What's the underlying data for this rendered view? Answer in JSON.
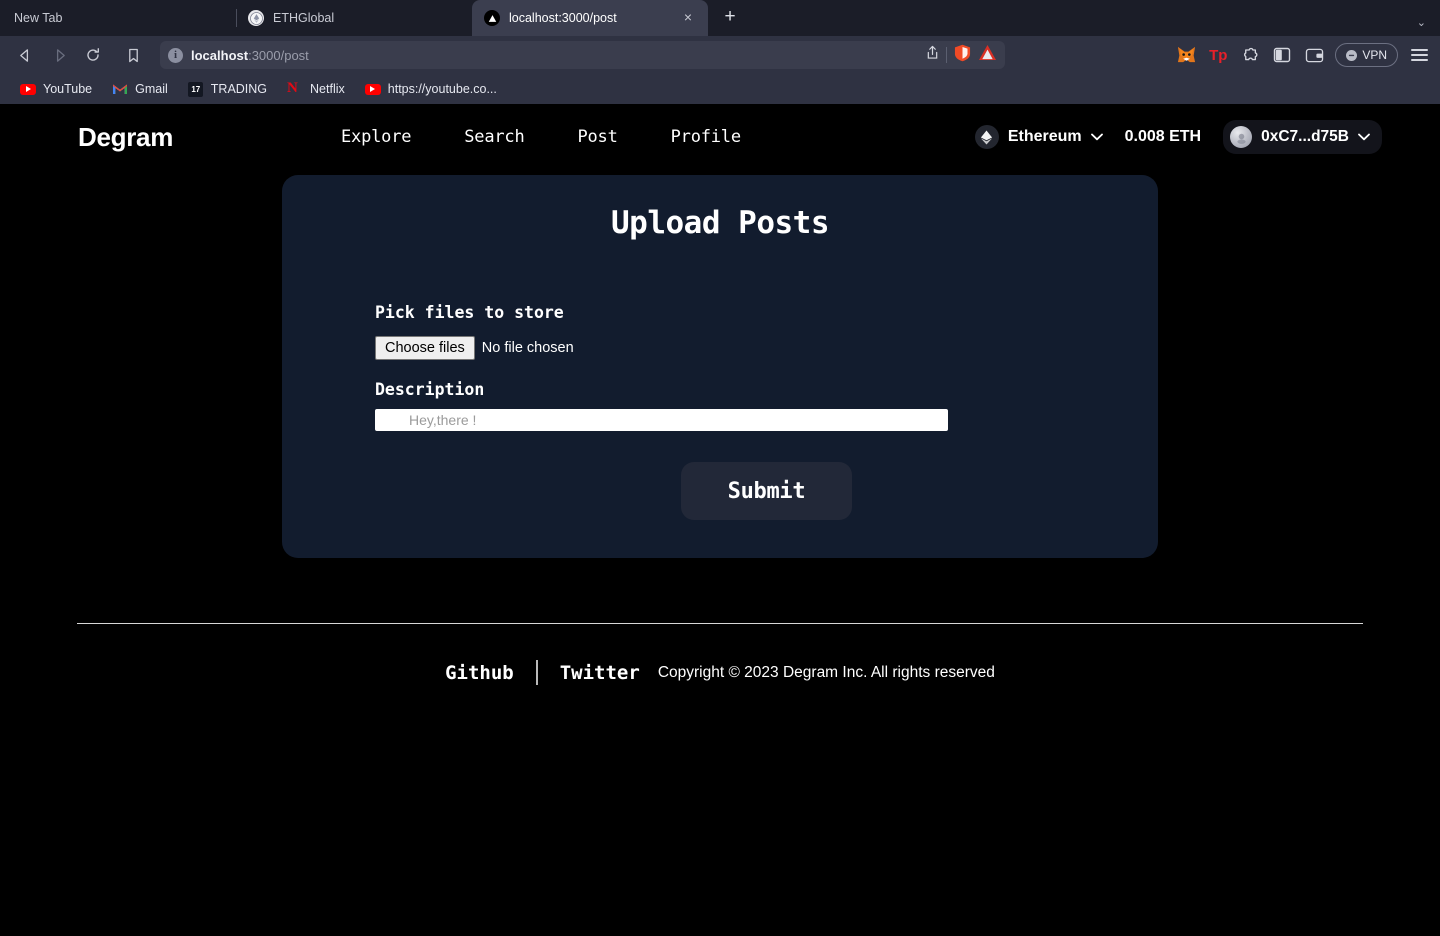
{
  "browser": {
    "tabs": [
      {
        "title": "New Tab",
        "favicon": "none",
        "active": false
      },
      {
        "title": "ETHGlobal",
        "favicon": "ethglobal-icon",
        "active": false
      },
      {
        "title": "localhost:3000/post",
        "favicon": "nextjs-icon",
        "active": true,
        "close_label": "×"
      }
    ],
    "new_tab_label": "+",
    "tab_list_chevron": "⌄",
    "nav": {
      "back_label": "◁",
      "forward_label": "▷",
      "reload_label": "⟳",
      "bookmark_label": "☐"
    },
    "omnibox": {
      "info_badge": "i",
      "url_host": "localhost",
      "url_path": ":3000/post",
      "share_label": "⇧",
      "shield_label": "🦁",
      "warning_label": "warning-triangle"
    },
    "extensions": [
      {
        "name": "metamask-icon",
        "glyph": "🦊"
      },
      {
        "name": "tp-wallet-icon",
        "glyph": "Tp"
      },
      {
        "name": "extensions-puzzle-icon",
        "glyph": "❖"
      },
      {
        "name": "sidebar-panel-icon",
        "glyph": "◧"
      },
      {
        "name": "wallet-icon",
        "glyph": "▤"
      }
    ],
    "vpn": {
      "label": "VPN",
      "dot": "−"
    },
    "menu_label": "menu",
    "bookmarks": [
      {
        "label": "YouTube",
        "icon": "youtube-icon"
      },
      {
        "label": "Gmail",
        "icon": "gmail-icon"
      },
      {
        "label": "TRADING",
        "icon": "tradingview-icon"
      },
      {
        "label": "Netflix",
        "icon": "netflix-icon"
      },
      {
        "label": "https://youtube.co...",
        "icon": "youtube-icon"
      }
    ]
  },
  "site": {
    "brand": "Degram",
    "nav_links": [
      {
        "label": "Explore"
      },
      {
        "label": "Search"
      },
      {
        "label": "Post"
      },
      {
        "label": "Profile"
      }
    ],
    "wallet": {
      "network": "Ethereum",
      "network_chevron": "⌄",
      "balance": "0.008 ETH",
      "address": "0xC7...d75B",
      "address_chevron": "⌄",
      "eth_glyph": "♦"
    }
  },
  "card": {
    "title": "Upload Posts",
    "file_label": "Pick files to store",
    "file_button": "Choose files",
    "file_status": "No file chosen",
    "description_label": "Description",
    "description_value": "",
    "description_placeholder": "Hey,there !",
    "submit_label": "Submit"
  },
  "footer": {
    "github": "Github",
    "twitter": "Twitter",
    "copyright": "Copyright © 2023 Degram Inc. All rights reserved"
  },
  "colors": {
    "page_bg": "#000000",
    "card_bg": "#121c2e",
    "submit_bg": "#222838",
    "browser_chrome": "#2f3242",
    "tab_strip": "#1b1d28",
    "active_tab": "#3b3e4f",
    "accent_red": "#e50914"
  }
}
